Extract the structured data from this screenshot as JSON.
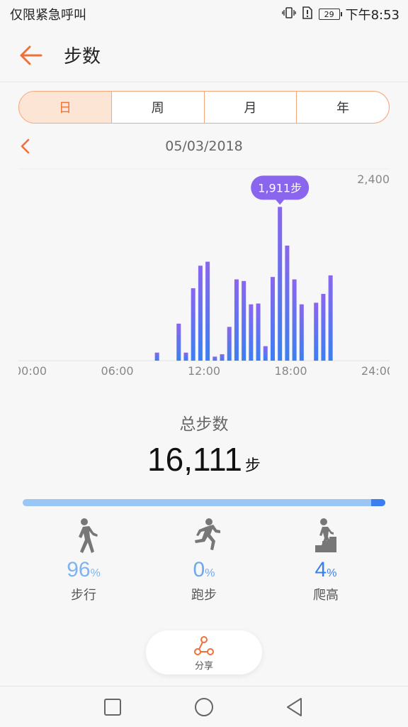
{
  "status_bar": {
    "left_text": "仅限紧急呼叫",
    "battery": "29",
    "time": "下午8:53"
  },
  "header": {
    "title": "步数"
  },
  "period_tabs": [
    "日",
    "周",
    "月",
    "年"
  ],
  "date": "05/03/2018",
  "chart_data": {
    "type": "bar",
    "unit": "步",
    "ylim": [
      0,
      2400
    ],
    "y_max_label": "2,400",
    "xlim": [
      0,
      24
    ],
    "x_ticks": [
      "00:00",
      "06:00",
      "12:00",
      "18:00",
      "24:00"
    ],
    "grid": false,
    "highlight": {
      "x": 17.75,
      "value": 1911,
      "label": "1,911步"
    },
    "bars": [
      {
        "x": 8.75,
        "value": 100
      },
      {
        "x": 10.25,
        "value": 460
      },
      {
        "x": 10.75,
        "value": 100
      },
      {
        "x": 11.25,
        "value": 900
      },
      {
        "x": 11.75,
        "value": 1180
      },
      {
        "x": 12.25,
        "value": 1230
      },
      {
        "x": 12.75,
        "value": 50
      },
      {
        "x": 13.25,
        "value": 80
      },
      {
        "x": 13.75,
        "value": 420
      },
      {
        "x": 14.25,
        "value": 1010
      },
      {
        "x": 14.75,
        "value": 990
      },
      {
        "x": 15.25,
        "value": 700
      },
      {
        "x": 15.75,
        "value": 710
      },
      {
        "x": 16.25,
        "value": 180
      },
      {
        "x": 16.75,
        "value": 1040
      },
      {
        "x": 17.25,
        "value": 1911
      },
      {
        "x": 17.75,
        "value": 1430
      },
      {
        "x": 18.25,
        "value": 1010
      },
      {
        "x": 18.75,
        "value": 700
      },
      {
        "x": 19.75,
        "value": 720
      },
      {
        "x": 20.25,
        "value": 830
      },
      {
        "x": 20.75,
        "value": 1060
      }
    ],
    "colors": {
      "bar_top": "#8a66ee",
      "bar_bottom": "#3b7ff2",
      "tooltip": "#8a66ee"
    }
  },
  "summary": {
    "total_label": "总步数",
    "total_value": "16,111",
    "total_unit": "步"
  },
  "progress": {
    "walk_fraction": 0.96,
    "run_fraction": 0.0,
    "climb_fraction": 0.04
  },
  "stats": [
    {
      "icon": "walking-icon",
      "value": "96",
      "unit": "%",
      "label": "步行",
      "color": "#7fb4f0"
    },
    {
      "icon": "running-icon",
      "value": "0",
      "unit": "%",
      "label": "跑步",
      "color": "#6fa8ee"
    },
    {
      "icon": "climbing-icon",
      "value": "4",
      "unit": "%",
      "label": "爬高",
      "color": "#3a7ff0"
    }
  ],
  "share": {
    "label": "分享"
  },
  "accent_color": "#f0703a"
}
